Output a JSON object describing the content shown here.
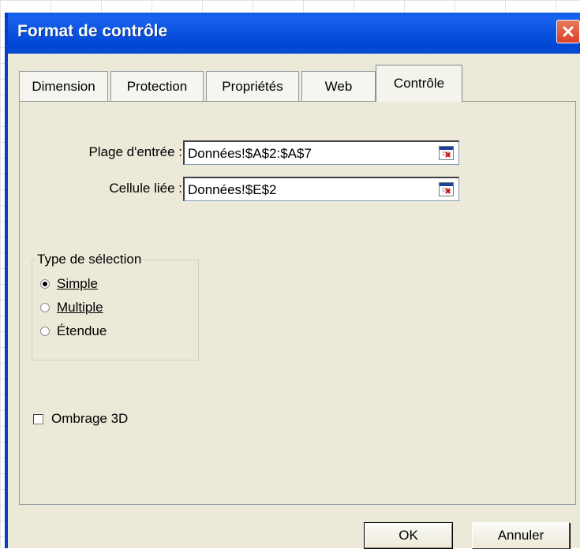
{
  "dialog": {
    "title": "Format de contrôle"
  },
  "tabs": [
    {
      "label": "Dimension",
      "active": false
    },
    {
      "label": "Protection",
      "active": false
    },
    {
      "label": "Propriétés",
      "active": false
    },
    {
      "label": "Web",
      "active": false
    },
    {
      "label": "Contrôle",
      "active": true
    }
  ],
  "fields": {
    "input_range": {
      "label": "Plage d'entrée :",
      "value": "Données!$A$2:$A$7"
    },
    "linked_cell": {
      "label": "Cellule liée :",
      "value": "Données!$E$2"
    }
  },
  "selection_type": {
    "legend": "Type de sélection",
    "options": [
      {
        "label": "Simple",
        "selected": true
      },
      {
        "label": "Multiple",
        "selected": false
      },
      {
        "label": "Étendue",
        "selected": false
      }
    ]
  },
  "shading_3d": {
    "label": "Ombrage 3D",
    "checked": false
  },
  "buttons": {
    "ok": "OK",
    "cancel": "Annuler"
  },
  "colors": {
    "titlebar": "#0046d5",
    "dialog_bg": "#ece9d8",
    "close": "#d9402a"
  },
  "icons": {
    "close": "close-icon",
    "range_picker": "range-picker-icon"
  }
}
